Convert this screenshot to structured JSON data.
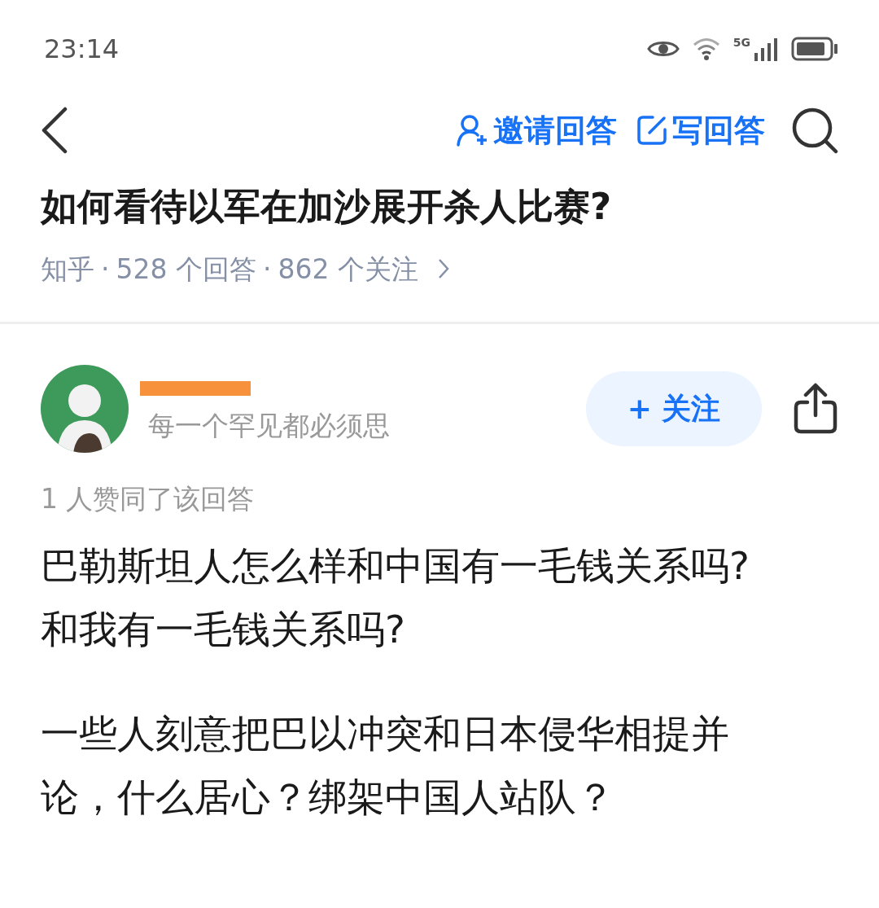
{
  "status_bar": {
    "time": "23:14",
    "network": "5G"
  },
  "top_bar": {
    "actions": [
      {
        "kind": "invite",
        "label": "邀请回答"
      },
      {
        "kind": "write",
        "label": "写回答"
      }
    ]
  },
  "question": {
    "title": "如何看待以军在加沙展开杀人比赛?",
    "source": "知乎",
    "separator": "·",
    "answers": "528 个回答",
    "followers": "862 个关注"
  },
  "author": {
    "redacted": true,
    "bio": "每一个罕见都必须思",
    "follow_button": "+ 关注"
  },
  "answer": {
    "likes": "1 人赞同了该回答",
    "paragraphs": [
      "巴勒斯坦人怎么样和中国有一毛钱关系吗?和我有一毛钱关系吗?",
      "一些人刻意把巴以冲突和日本侵华相提并论，什么居心？绑架中国人站队？"
    ]
  }
}
